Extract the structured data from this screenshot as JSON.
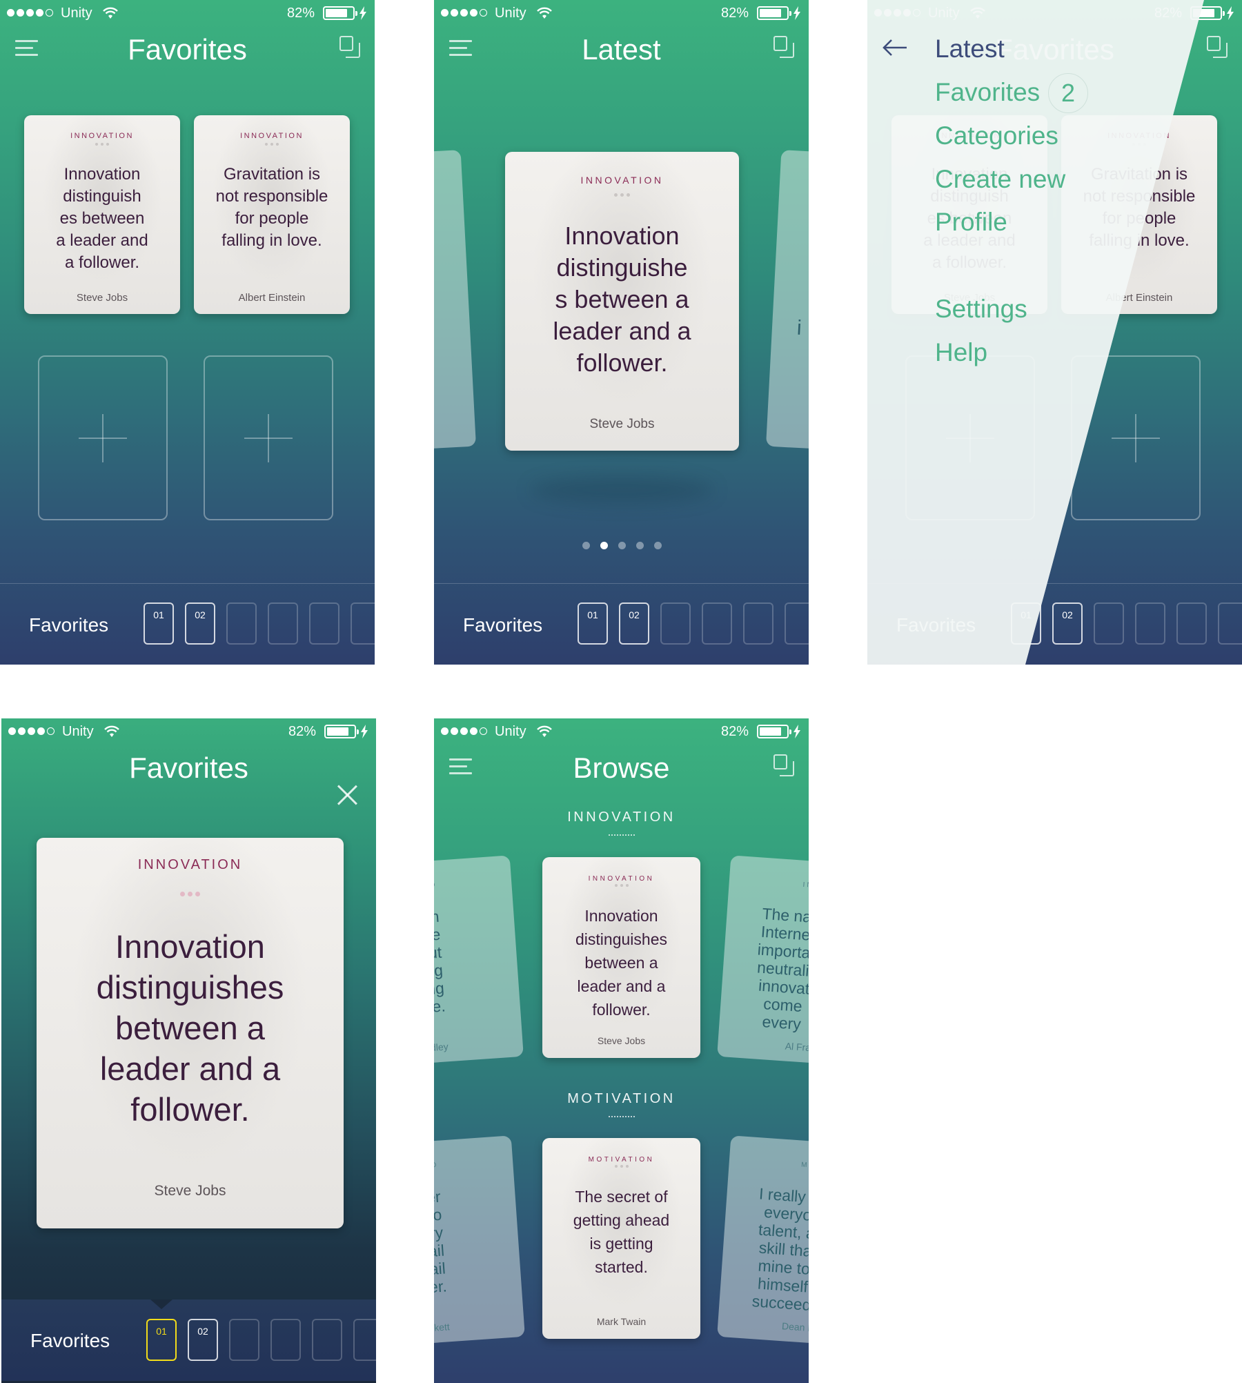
{
  "status": {
    "carrier": "Unity",
    "battery": "82%",
    "battery_level": 0.82
  },
  "colors": {
    "green_top": "#3cb27f",
    "navy_bottom": "#2e3f6c",
    "category": "#8a2a55",
    "quote_text": "#3b1e3d",
    "menu_active": "#3d4c7a",
    "menu_item": "#4fb48b",
    "selected_slot": "#f2dc1a"
  },
  "screens": {
    "favorites": {
      "title": "Favorites",
      "cards": [
        {
          "category": "INNOVATION",
          "lines": [
            "Innovation",
            "distinguish",
            "es between",
            "a leader and",
            "a follower."
          ],
          "author": "Steve Jobs"
        },
        {
          "category": "INNOVATION",
          "lines": [
            "Gravitation is",
            "not responsible",
            "for people",
            "falling in love."
          ],
          "author": "Albert Einstein"
        }
      ],
      "bottom": {
        "label": "Favorites",
        "slots": [
          "01",
          "02",
          "",
          "",
          "",
          ""
        ]
      }
    },
    "latest": {
      "title": "Latest",
      "card": {
        "category": "INNOVATION",
        "lines": [
          "Innovation",
          "distinguishe",
          "s between a",
          "leader and a",
          "follower."
        ],
        "author": "Steve Jobs"
      },
      "right_fragment": {
        "lines": [
          "i"
        ]
      },
      "pager": {
        "count": 5,
        "active": 2
      },
      "bottom": {
        "label": "Favorites",
        "slots": [
          "01",
          "02",
          "",
          "",
          "",
          ""
        ]
      }
    },
    "menu": {
      "items": [
        {
          "label": "Latest",
          "active": true
        },
        {
          "label": "Favorites",
          "badge": "2"
        },
        {
          "label": "Categories"
        },
        {
          "label": "Create new"
        },
        {
          "label": "Profile"
        },
        {
          "label": "Settings"
        },
        {
          "label": "Help"
        }
      ]
    },
    "detail": {
      "title": "Favorites",
      "card": {
        "category": "INNOVATION",
        "lines": [
          "Innovation",
          "distinguishes",
          "between a",
          "leader and a",
          "follower."
        ],
        "author": "Steve Jobs"
      },
      "bottom": {
        "label": "Favorites",
        "slots": [
          "01",
          "02",
          "",
          "",
          "",
          ""
        ],
        "selected": "01"
      }
    },
    "browse": {
      "title": "Browse",
      "sections": [
        {
          "heading": "INNOVATION",
          "center": {
            "category": "INNOVATION",
            "lines": [
              "Innovation",
              "distinguishes",
              "between a",
              "leader and a",
              "follower."
            ],
            "author": "Steve Jobs"
          },
          "left": {
            "category": "TIO",
            "lines": [
              "ent can",
              "rage",
              "on, but",
              "y doing",
              "t doing",
              "ore."
            ],
            "author": "Ridley"
          },
          "right": {
            "category": "INN",
            "lines": [
              "The nat",
              "Internet",
              "importar",
              "neutralit",
              "innovat",
              "come",
              "every"
            ],
            "author": "Al Fran"
          }
        },
        {
          "heading": "MOTIVATION",
          "center": {
            "category": "MOTIVATION",
            "lines": [
              "The secret of",
              "getting ahead",
              "is getting",
              "started."
            ],
            "author": "Mark Twain"
          },
          "left": {
            "category": "TIO",
            "lines": [
              "ed. Ever",
              "d. No",
              "er. Try",
              "n. Fail",
              "n. Fail",
              "tter."
            ],
            "author": "el Beckett"
          },
          "right": {
            "category": "MOT",
            "lines": [
              "I really b",
              "everyo",
              "talent, a",
              "skill tha",
              "mine to",
              "himself",
              "succeed"
            ],
            "author": "Dean Ko"
          }
        }
      ]
    }
  }
}
